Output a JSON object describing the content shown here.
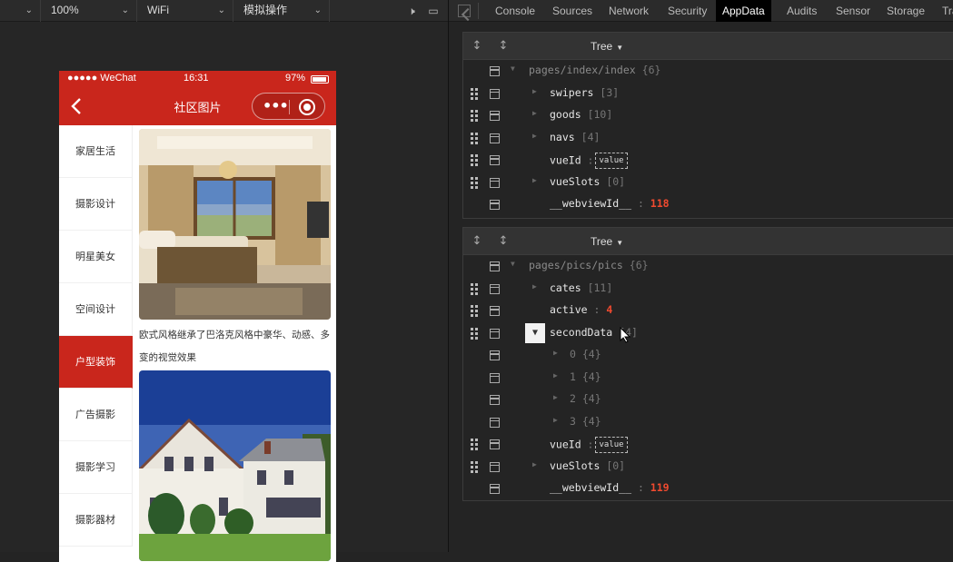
{
  "toolbar": {
    "device_dd": "",
    "zoom": "100%",
    "network": "WiFi",
    "operation": "模拟操作"
  },
  "phone": {
    "status": {
      "signal": "●●●●● WeChat",
      "time": "16:31",
      "battery": "97%"
    },
    "nav_title": "社区图片",
    "categories": [
      "家居生活",
      "摄影设计",
      "明星美女",
      "空间设计",
      "户型装饰",
      "广告摄影",
      "摄影学习",
      "摄影器材"
    ],
    "active_category_index": 4,
    "pic_desc_1": "欧式风格继承了巴洛克风格中豪华、动感、多变的视觉效果"
  },
  "devtools": {
    "tabs": [
      "Console",
      "Sources",
      "Network",
      "Security",
      "AppData",
      "Audits",
      "Sensor",
      "Storage",
      "Tra"
    ],
    "active_tab": "AppData",
    "panel1": {
      "mode": "Tree",
      "root": "pages/index/index",
      "root_meta": "{6}",
      "rows": [
        {
          "key": "swipers",
          "meta": "[3]"
        },
        {
          "key": "goods",
          "meta": "[10]"
        },
        {
          "key": "navs",
          "meta": "[4]"
        },
        {
          "key": "vueId",
          "tag": "value"
        },
        {
          "key": "vueSlots",
          "meta": "[0]"
        },
        {
          "key": "__webviewId__",
          "num": "118"
        }
      ]
    },
    "panel2": {
      "mode": "Tree",
      "root": "pages/pics/pics",
      "root_meta": "{6}",
      "rows": [
        {
          "key": "cates",
          "meta": "[11]"
        },
        {
          "key": "active",
          "num": "4"
        },
        {
          "key": "secondData",
          "meta": "[4]"
        },
        {
          "key": "0",
          "meta": "{4}"
        },
        {
          "key": "1",
          "meta": "{4}"
        },
        {
          "key": "2",
          "meta": "{4}"
        },
        {
          "key": "3",
          "meta": "{4}"
        },
        {
          "key": "vueId",
          "tag": "value"
        },
        {
          "key": "vueSlots",
          "meta": "[0]"
        },
        {
          "key": "__webviewId__",
          "num": "119"
        }
      ]
    }
  },
  "colors": {
    "brand_red": "#c9261c",
    "number": "#f04a2f",
    "active_tab_bg": "#000000"
  }
}
